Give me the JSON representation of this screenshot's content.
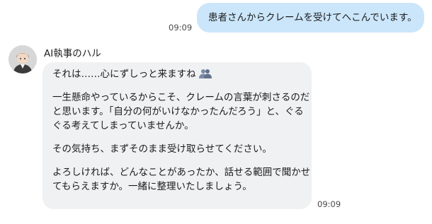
{
  "outgoing": {
    "text": "患者さんからクレームを受けてへこんでいます。",
    "time": "09:09"
  },
  "incoming": {
    "sender": "AI執事のハル",
    "avatar_icon": "butler-avatar-icon",
    "lines": [
      "それは……心にずしっと来ますね",
      "一生懸命やっているからこそ、クレームの言葉が刺さるのだ",
      "と思います。「自分の何がいけなかったんだろう」と、ぐる",
      "ぐる考えてしまっていませんか。",
      "その気持ち、まずそのまま受け取らせてください。",
      "よろしければ、どんなことがあったか、話せる範囲で聞かせ",
      "てもらえますか。一緒に整理いたしましょう。"
    ],
    "emoji_icon": "two-people-icon",
    "time": "09:09"
  },
  "colors": {
    "outgoing_bubble": "#cbe6fb",
    "incoming_bubble": "#f0f1f3",
    "timestamp": "#4a4a4a"
  }
}
